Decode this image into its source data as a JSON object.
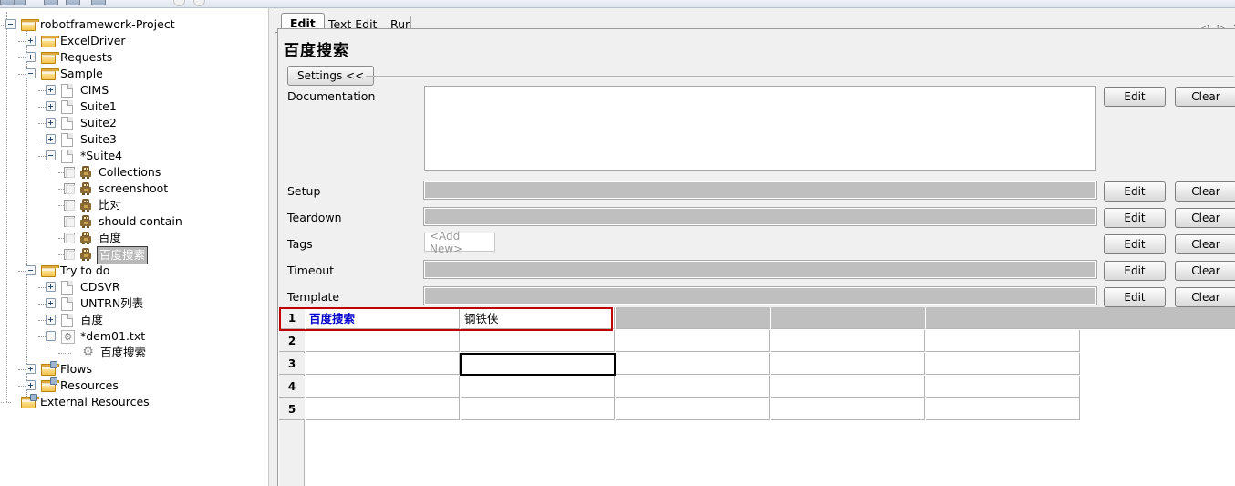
{
  "window": {
    "toolbar_icons": [
      "new-icon",
      "open-icon",
      "save-icon",
      "save-all-icon",
      "search-icon",
      "run-icon"
    ]
  },
  "tree": {
    "items": [
      {
        "label": "robotframework-Project",
        "icon": "folder-icon",
        "indent": 0,
        "expander": "minus",
        "selected": false
      },
      {
        "label": "ExcelDriver",
        "icon": "folder-icon",
        "indent": 1,
        "expander": "plus",
        "selected": false
      },
      {
        "label": "Requests",
        "icon": "folder-icon",
        "indent": 1,
        "expander": "plus",
        "selected": false
      },
      {
        "label": "Sample",
        "icon": "folder-icon",
        "indent": 1,
        "expander": "minus",
        "selected": false
      },
      {
        "label": "CIMS",
        "icon": "file-icon",
        "indent": 2,
        "expander": "plus",
        "selected": false
      },
      {
        "label": "Suite1",
        "icon": "file-icon",
        "indent": 2,
        "expander": "plus",
        "selected": false
      },
      {
        "label": "Suite2",
        "icon": "file-icon",
        "indent": 2,
        "expander": "plus",
        "selected": false
      },
      {
        "label": "Suite3",
        "icon": "file-icon",
        "indent": 2,
        "expander": "plus",
        "selected": false
      },
      {
        "label": "*Suite4",
        "icon": "file-icon",
        "indent": 2,
        "expander": "minus",
        "selected": false
      },
      {
        "label": "Collections",
        "icon": "robot-icon",
        "indent": 3,
        "expander": "none",
        "checkbox": true,
        "selected": false
      },
      {
        "label": "screenshoot",
        "icon": "robot-icon",
        "indent": 3,
        "expander": "none",
        "checkbox": true,
        "selected": false
      },
      {
        "label": "比对",
        "icon": "robot-icon",
        "indent": 3,
        "expander": "none",
        "checkbox": true,
        "selected": false
      },
      {
        "label": "should contain",
        "icon": "robot-icon",
        "indent": 3,
        "expander": "none",
        "checkbox": true,
        "selected": false
      },
      {
        "label": "百度",
        "icon": "robot-icon",
        "indent": 3,
        "expander": "none",
        "checkbox": true,
        "selected": false
      },
      {
        "label": "百度搜索",
        "icon": "robot-icon",
        "indent": 3,
        "expander": "none",
        "checkbox": true,
        "selected": true
      },
      {
        "label": "Try to do",
        "icon": "folder-icon",
        "indent": 1,
        "expander": "minus",
        "selected": false
      },
      {
        "label": "CDSVR",
        "icon": "file-icon",
        "indent": 2,
        "expander": "plus",
        "selected": false
      },
      {
        "label": "UNTRN列表",
        "icon": "file-icon",
        "indent": 2,
        "expander": "plus",
        "selected": false
      },
      {
        "label": "百度",
        "icon": "file-icon",
        "indent": 2,
        "expander": "plus",
        "selected": false
      },
      {
        "label": "*dem01.txt",
        "icon": "gear-file-icon",
        "indent": 2,
        "expander": "minus",
        "selected": false
      },
      {
        "label": "百度搜索",
        "icon": "gear-icon",
        "indent": 3,
        "expander": "none",
        "selected": false
      },
      {
        "label": "Flows",
        "icon": "resource-folder-icon",
        "indent": 1,
        "expander": "plus",
        "selected": false
      },
      {
        "label": "Resources",
        "icon": "resource-folder-icon",
        "indent": 1,
        "expander": "plus",
        "selected": false
      },
      {
        "label": "External Resources",
        "icon": "resource-folder-icon",
        "indent": 0,
        "expander": "none",
        "selected": false
      }
    ]
  },
  "editor": {
    "tabs": [
      {
        "label": "Edit",
        "active": true
      },
      {
        "label": "Text Edit",
        "active": false
      },
      {
        "label": "Run",
        "active": false
      }
    ],
    "nav": {
      "prev_icon": "triangle-left-icon",
      "prev_glyph": "◁",
      "next_icon": "triangle-right-icon",
      "next_glyph": "▷",
      "close_icon": "close-icon",
      "close_glyph": "✕"
    },
    "title": "百度搜索",
    "settings_button": "Settings <<",
    "fields": [
      {
        "label": "Documentation",
        "type": "textarea",
        "value": "",
        "edit": "Edit",
        "clear": "Clear"
      },
      {
        "label": "Setup",
        "type": "grey",
        "value": "",
        "edit": "Edit",
        "clear": "Clear"
      },
      {
        "label": "Teardown",
        "type": "grey",
        "value": "",
        "edit": "Edit",
        "clear": "Clear"
      },
      {
        "label": "Tags",
        "type": "tags",
        "placeholder": "<Add New>",
        "edit": "Edit",
        "clear": "Clear"
      },
      {
        "label": "Timeout",
        "type": "grey",
        "value": "",
        "edit": "Edit",
        "clear": "Clear"
      },
      {
        "label": "Template",
        "type": "grey",
        "value": "",
        "edit": "Edit",
        "clear": "Clear"
      }
    ],
    "grid": {
      "row_numbers": [
        "1",
        "2",
        "3",
        "4",
        "5"
      ],
      "rows": [
        {
          "cells": [
            "百度搜索",
            "钢铁侠",
            "",
            "",
            ""
          ],
          "keyword_cell": 0,
          "selected": true,
          "disabled_tail": true
        },
        {
          "cells": [
            "",
            "",
            "",
            "",
            ""
          ]
        },
        {
          "cells": [
            "",
            "",
            "",
            "",
            ""
          ],
          "active_cell": 1
        },
        {
          "cells": [
            "",
            "",
            "",
            "",
            ""
          ]
        },
        {
          "cells": [
            "",
            "",
            "",
            "",
            ""
          ]
        }
      ]
    }
  },
  "colors": {
    "keyword_blue": "#0000cc",
    "selection_red": "#c00000",
    "active_cell_black": "#000000",
    "panel_grey": "#f0f0f0",
    "field_grey": "#bfbfbf"
  }
}
